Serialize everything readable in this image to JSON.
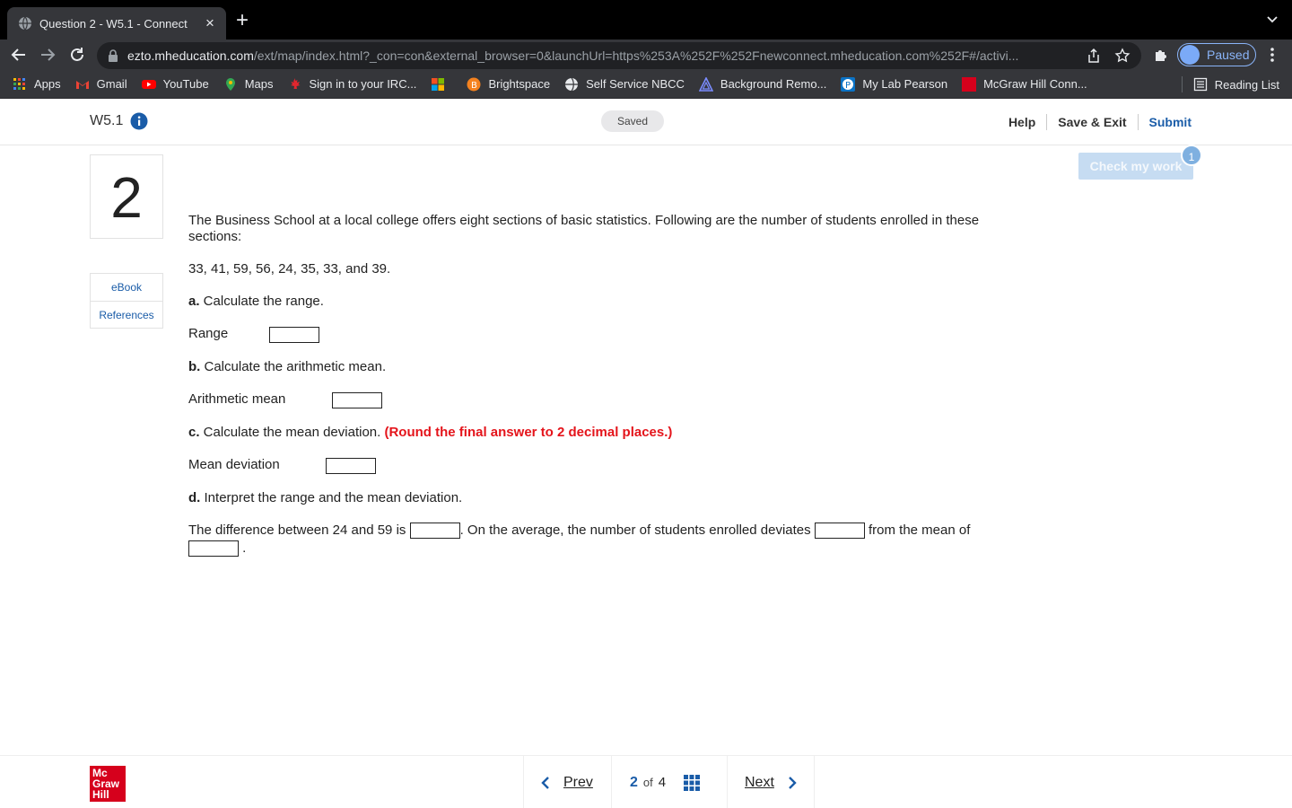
{
  "browser": {
    "tab_title": "Question 2 - W5.1 - Connect",
    "url_host": "ezto.mheducation.com",
    "url_path": "/ext/map/index.html?_con=con&external_browser=0&launchUrl=https%253A%252F%252Fnewconnect.mheducation.com%252F#/activi...",
    "profile_label": "Paused",
    "bookmarks": [
      "Apps",
      "Gmail",
      "YouTube",
      "Maps",
      "Sign in to your IRC...",
      "Brightspace",
      "Self Service NBCC",
      "Background Remo...",
      "My Lab Pearson",
      "McGraw Hill Conn..."
    ],
    "reading_list": "Reading List"
  },
  "header": {
    "assignment": "W5.1",
    "saved": "Saved",
    "help": "Help",
    "save_exit": "Save & Exit",
    "submit": "Submit"
  },
  "question": {
    "number": "2",
    "check_my_work": "Check my work",
    "check_badge": "1",
    "ebook": "eBook",
    "references": "References",
    "intro": "The Business School at a local college offers eight sections of basic statistics. Following are the number of students enrolled in these sections:",
    "data": "33, 41, 59, 56, 24, 35, 33, and 39.",
    "a_label": "a.",
    "a_text": " Calculate the range.",
    "range_label": "Range",
    "b_label": "b.",
    "b_text": " Calculate the arithmetic mean.",
    "mean_label": "Arithmetic mean",
    "c_label": "c.",
    "c_text": " Calculate the mean deviation. ",
    "c_note": "(Round the final answer to 2 decimal places.)",
    "md_label": "Mean deviation",
    "d_label": "d.",
    "d_text": " Interpret the range and the mean deviation.",
    "interp_1": "The difference between 24 and 59 is ",
    "interp_2": ". On the average, the number of students enrolled deviates ",
    "interp_3": " from the mean of",
    "interp_4": "."
  },
  "footer": {
    "logo_lines": [
      "Mc",
      "Graw",
      "Hill"
    ],
    "prev": "Prev",
    "current": "2",
    "of": "of",
    "total": "4",
    "next": "Next"
  }
}
